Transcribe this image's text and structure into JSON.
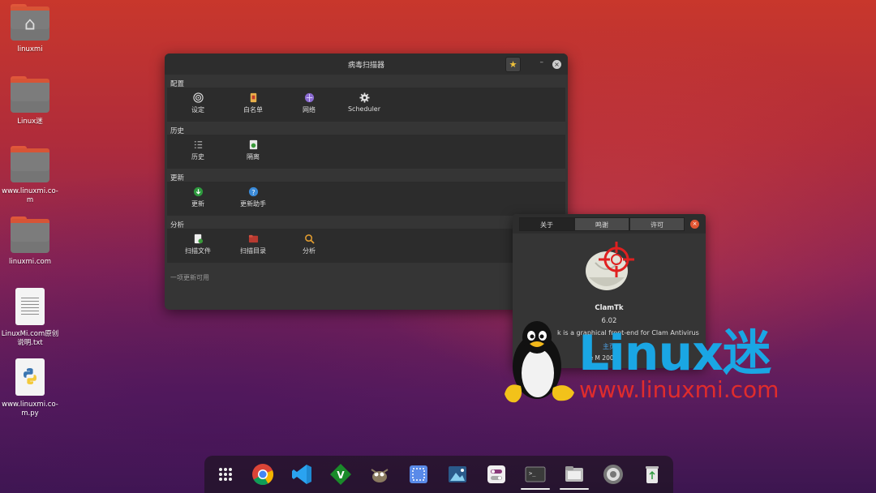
{
  "desktop": {
    "icons": [
      {
        "label": "linuxmi",
        "kind": "home-folder"
      },
      {
        "label": "Linux迷",
        "kind": "folder"
      },
      {
        "label": "www.linuxmi.co-m",
        "kind": "folder"
      },
      {
        "label": "linuxmi.com",
        "kind": "folder"
      },
      {
        "label": "LinuxMi.com原创说明.txt",
        "kind": "text-file"
      },
      {
        "label": "www.linuxmi.co-m.py",
        "kind": "python-file"
      }
    ]
  },
  "scanner_window": {
    "title": "病毒扫描器",
    "sections": [
      {
        "label": "配置",
        "items": [
          {
            "label": "设定",
            "icon": "settings-target-icon"
          },
          {
            "label": "白名单",
            "icon": "whitelist-icon"
          },
          {
            "label": "网络",
            "icon": "network-icon"
          },
          {
            "label": "Scheduler",
            "icon": "scheduler-gear-icon"
          }
        ]
      },
      {
        "label": "历史",
        "items": [
          {
            "label": "历史",
            "icon": "history-list-icon"
          },
          {
            "label": "隔离",
            "icon": "quarantine-icon"
          }
        ]
      },
      {
        "label": "更新",
        "items": [
          {
            "label": "更新",
            "icon": "update-icon"
          },
          {
            "label": "更新助手",
            "icon": "update-assistant-icon"
          }
        ]
      },
      {
        "label": "分析",
        "items": [
          {
            "label": "扫描文件",
            "icon": "scan-file-icon"
          },
          {
            "label": "扫描目录",
            "icon": "scan-folder-icon"
          },
          {
            "label": "分析",
            "icon": "analysis-icon"
          }
        ]
      }
    ],
    "status": "一项更新可用"
  },
  "about_dialog": {
    "tabs": [
      "关于",
      "鸣谢",
      "许可"
    ],
    "active_tab": "关于",
    "app_name": "ClamTk",
    "version": "6.02",
    "description": "k is a graphical front-end for Clam Antivirus",
    "website_label": "主页",
    "copyright": "ve M 2004",
    "copyright_tail": "9"
  },
  "watermark": {
    "brand": "Linux迷",
    "url": "www.linuxmi.com"
  },
  "dock": {
    "items": [
      "apps-grid-icon",
      "chrome-icon",
      "vscode-icon",
      "vim-icon",
      "gimp-icon",
      "screenshot-icon",
      "image-viewer-icon",
      "tweaks-icon",
      "terminal-icon",
      "files-icon",
      "settings-icon",
      "trash-icon"
    ]
  },
  "colors": {
    "accent_blue": "#1aa6e4",
    "accent_red": "#e02c2c",
    "link": "#4ea3e8",
    "close_orange": "#e05632"
  }
}
